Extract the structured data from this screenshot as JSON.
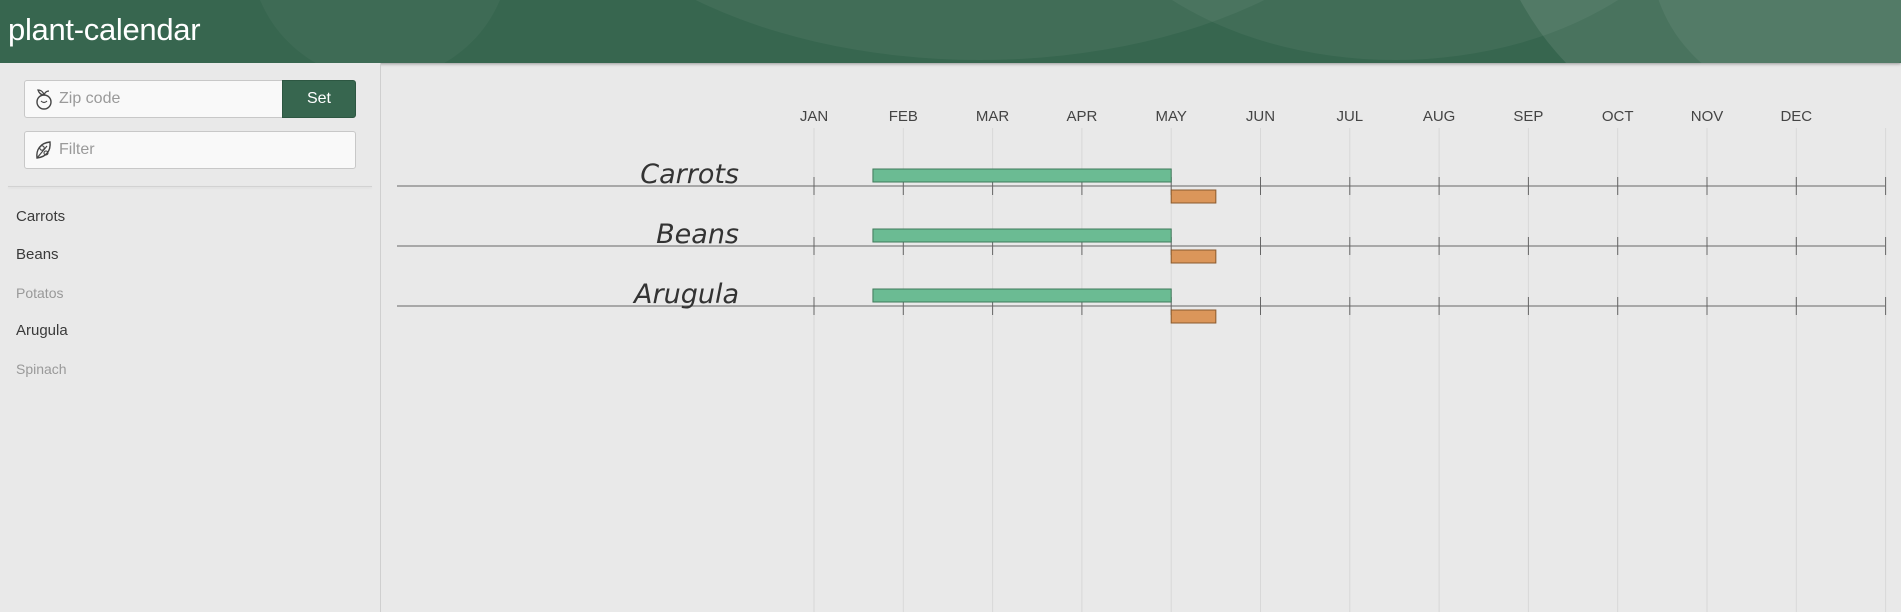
{
  "app": {
    "title": "plant-calendar"
  },
  "sidebar": {
    "zip": {
      "placeholder": "Zip code",
      "icon": "sprout-icon"
    },
    "set_label": "Set",
    "filter": {
      "placeholder": "Filter",
      "icon": "leaf-icon"
    },
    "plants": [
      {
        "label": "Carrots",
        "active": true
      },
      {
        "label": "Beans",
        "active": true
      },
      {
        "label": "Potatos",
        "active": false
      },
      {
        "label": "Arugula",
        "active": true
      },
      {
        "label": "Spinach",
        "active": false
      }
    ]
  },
  "colors": {
    "header": "#37664f",
    "indoor_bar": "#6bbb93",
    "transplant_bar": "#db965a"
  },
  "timeline": {
    "months": [
      "JAN",
      "FEB",
      "MAR",
      "APR",
      "MAY",
      "JUN",
      "JUL",
      "AUG",
      "SEP",
      "OCT",
      "NOV",
      "DEC"
    ],
    "rows": [
      {
        "name": "Carrots",
        "start_indoors": [
          1.66,
          5.0
        ],
        "transplant": [
          5.0,
          5.5
        ]
      },
      {
        "name": "Beans",
        "start_indoors": [
          1.66,
          5.0
        ],
        "transplant": [
          5.0,
          5.5
        ]
      },
      {
        "name": "Arugula",
        "start_indoors": [
          1.66,
          5.0
        ],
        "transplant": [
          5.0,
          5.5
        ]
      }
    ]
  }
}
